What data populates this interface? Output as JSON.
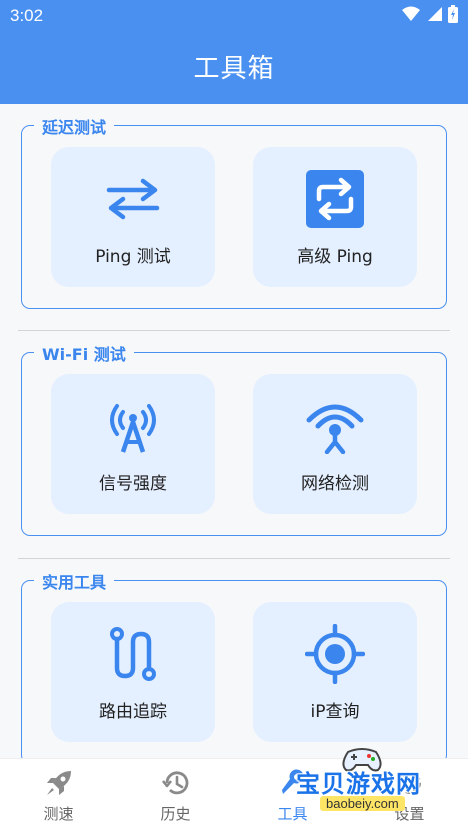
{
  "status_bar": {
    "time": "3:02"
  },
  "app_bar": {
    "title": "工具箱"
  },
  "sections": [
    {
      "title": "延迟测试",
      "tiles": [
        {
          "label": "Ping 测试",
          "icon": "swap-arrows-icon"
        },
        {
          "label": "高级 Ping",
          "icon": "repeat-square-icon"
        }
      ]
    },
    {
      "title": "Wi-Fi 测试",
      "tiles": [
        {
          "label": "信号强度",
          "icon": "signal-tower-icon"
        },
        {
          "label": "网络检测",
          "icon": "wifi-antenna-icon"
        }
      ]
    },
    {
      "title": "实用工具",
      "tiles": [
        {
          "label": "路由追踪",
          "icon": "route-icon"
        },
        {
          "label": "iP查询",
          "icon": "crosshair-icon"
        }
      ]
    }
  ],
  "bottom_nav": [
    {
      "label": "测速",
      "icon": "rocket-icon"
    },
    {
      "label": "历史",
      "icon": "history-icon"
    },
    {
      "label": "工具",
      "icon": "wrench-icon",
      "active": true
    },
    {
      "label": "设置",
      "icon": "gear-icon"
    }
  ],
  "watermark": {
    "text": "宝贝游戏网",
    "sub": "baobeiy.com"
  },
  "colors": {
    "primary": "#4a90f0",
    "tile_bg": "#e4efff",
    "accent_text": "#3a86ee"
  }
}
